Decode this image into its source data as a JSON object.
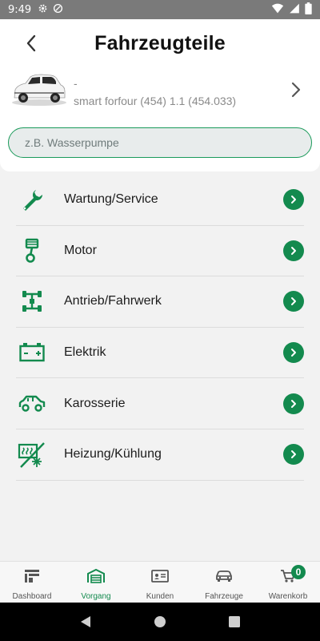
{
  "status_bar": {
    "time": "9:49",
    "left_icons": [
      "gear-icon",
      "no-disturb-icon"
    ],
    "right_icons": [
      "wifi-icon",
      "signal-icon",
      "battery-icon"
    ]
  },
  "header": {
    "title": "Fahrzeugteile",
    "back_icon": "chevron-left-icon"
  },
  "vehicle": {
    "name": "-",
    "model": "smart forfour (454) 1.1 (454.033)"
  },
  "search": {
    "placeholder": "z.B. Wasserpumpe",
    "value": ""
  },
  "menu": {
    "items": [
      {
        "label": "Wartung/Service",
        "icon": "wrench-icon"
      },
      {
        "label": "Motor",
        "icon": "piston-icon"
      },
      {
        "label": "Antrieb/Fahrwerk",
        "icon": "chassis-icon"
      },
      {
        "label": "Elektrik",
        "icon": "battery-icon"
      },
      {
        "label": "Karosserie",
        "icon": "car-body-icon"
      },
      {
        "label": "Heizung/Kühlung",
        "icon": "heating-cooling-icon"
      }
    ]
  },
  "bottom_nav": {
    "items": [
      {
        "label": "Dashboard",
        "icon": "dashboard-icon",
        "active": false
      },
      {
        "label": "Vorgang",
        "icon": "garage-icon",
        "active": true
      },
      {
        "label": "Kunden",
        "icon": "contact-card-icon",
        "active": false
      },
      {
        "label": "Fahrzeuge",
        "icon": "car-icon",
        "active": false
      },
      {
        "label": "Warenkorb",
        "icon": "cart-icon",
        "active": false
      }
    ],
    "cart_count": "0"
  },
  "colors": {
    "accent": "#138a4e",
    "status_bar": "#7a7a7a",
    "background": "#f2f2f2"
  }
}
